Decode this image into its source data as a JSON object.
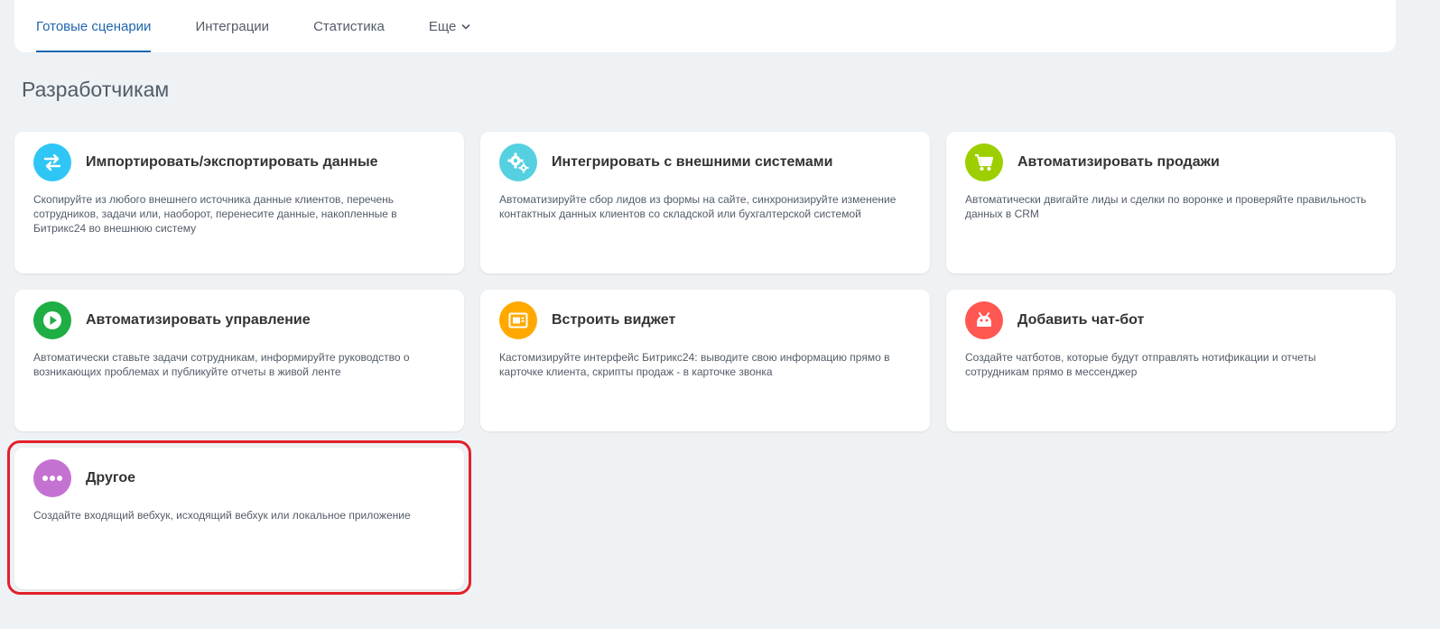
{
  "tabs": [
    {
      "label": "Готовые сценарии",
      "active": true
    },
    {
      "label": "Интеграции",
      "active": false
    },
    {
      "label": "Статистика",
      "active": false
    },
    {
      "label": "Еще",
      "active": false
    }
  ],
  "page_title": "Разработчикам",
  "cards": [
    {
      "title": "Импортировать/экспортировать данные",
      "description": "Скопируйте из любого внешнего источника данные клиентов, перечень сотрудников, задачи или, наоборот, перенесите данные, накопленные в Битрикс24 во внешнюю систему",
      "icon": "arrows-exchange-icon",
      "color": "#2fc6f6"
    },
    {
      "title": "Интегрировать с внешними системами",
      "description": "Автоматизируйте сбор лидов из формы на сайте, синхронизируйте изменение контактных данных клиентов со складской или бухгалтерской системой",
      "icon": "gears-icon",
      "color": "#55d0e0"
    },
    {
      "title": "Автоматизировать продажи",
      "description": "Автоматически двигайте лиды и сделки по воронке и проверяйте правильность данных в CRM",
      "icon": "cart-icon",
      "color": "#9dcf00"
    },
    {
      "title": "Автоматизировать управление",
      "description": "Автоматически ставьте задачи сотрудникам, информируйте руководство о возникающих проблемах и публикуйте отчеты в живой ленте",
      "icon": "play-icon",
      "color": "#1eae43"
    },
    {
      "title": "Встроить виджет",
      "description": "Кастомизируйте интерфейс Битрикс24: выводите свою информацию прямо в карточке клиента, скрипты продаж - в карточке звонка",
      "icon": "widget-icon",
      "color": "#ffa900"
    },
    {
      "title": "Добавить чат-бот",
      "description": "Создайте чатботов, которые будут отправлять нотификации и отчеты сотрудникам прямо в мессенджер",
      "icon": "robot-icon",
      "color": "#ff5752"
    },
    {
      "title": "Другое",
      "description": "Создайте входящий вебхук, исходящий вебхук или локальное приложение",
      "icon": "dots-icon",
      "color": "#c472d2"
    }
  ],
  "colors": {
    "accent": "#2067b0",
    "highlight": "#e3202b"
  }
}
